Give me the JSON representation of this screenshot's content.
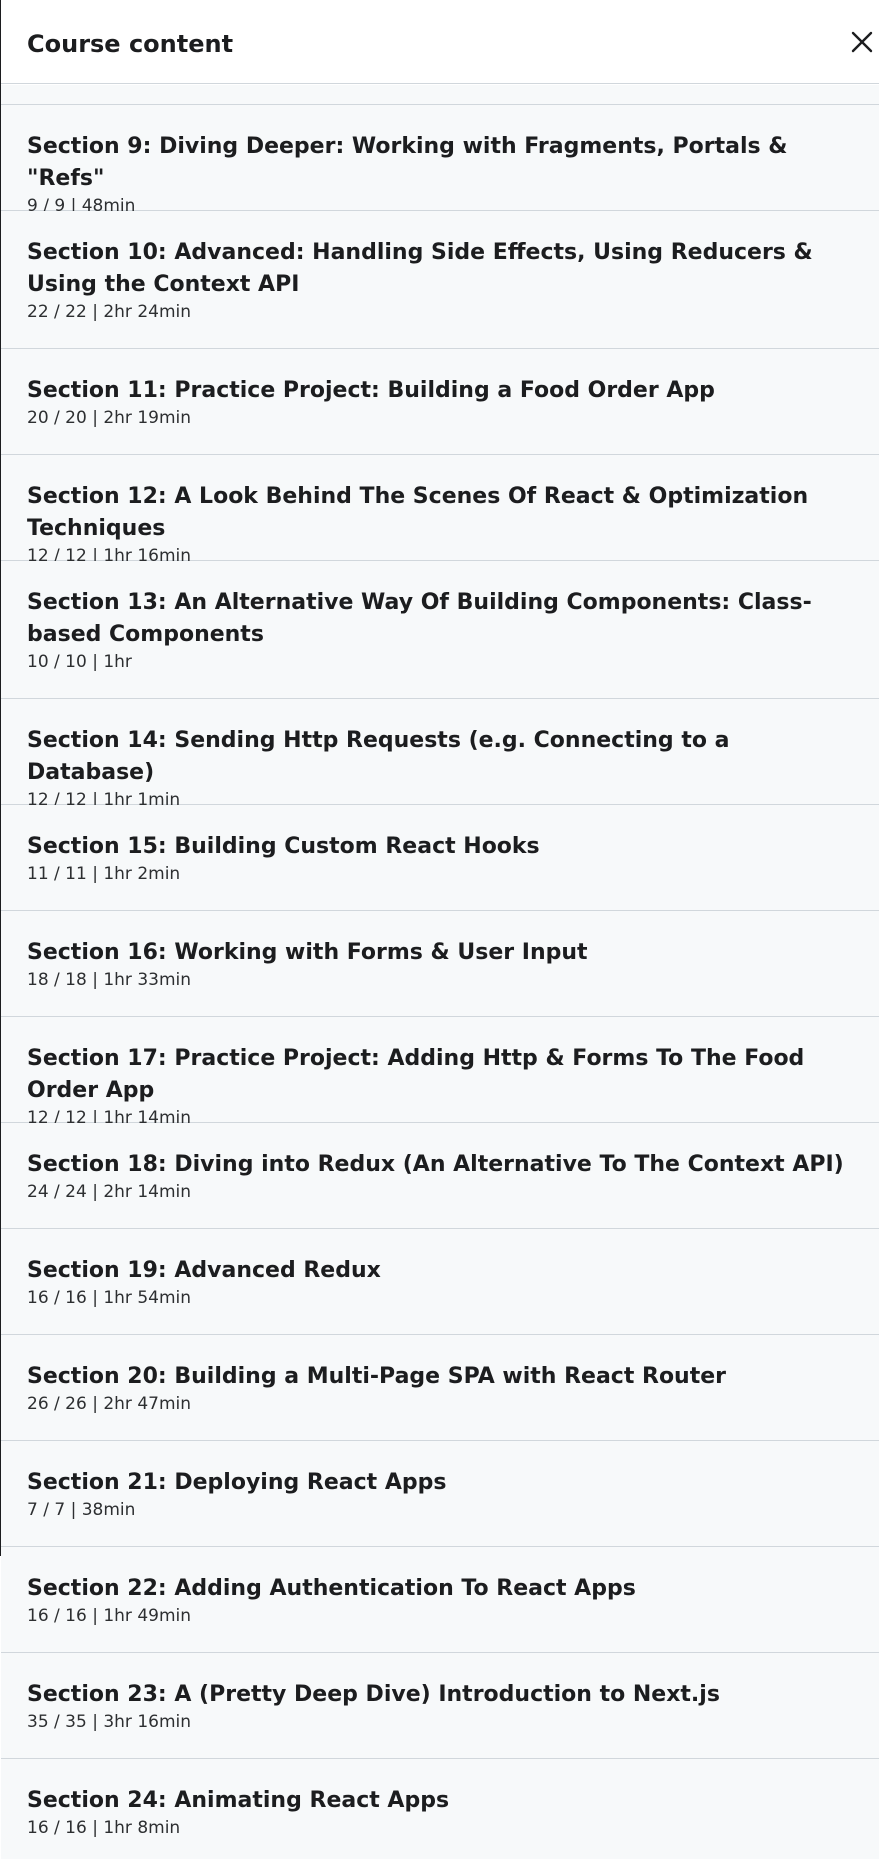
{
  "header": {
    "title": "Course content",
    "close_icon": "close-icon"
  },
  "sections": [
    {
      "title": "Section 9: Diving Deeper: Working with Fragments, Portals & \"Refs\"",
      "meta": "9 / 9 | 48min"
    },
    {
      "title": "Section 10: Advanced: Handling Side Effects, Using Reducers & Using the Context API",
      "meta": "22 / 22 | 2hr 24min"
    },
    {
      "title": "Section 11: Practice Project: Building a Food Order App",
      "meta": "20 / 20 | 2hr 19min"
    },
    {
      "title": "Section 12: A Look Behind The Scenes Of React & Optimization Techniques",
      "meta": "12 / 12 | 1hr 16min"
    },
    {
      "title": "Section 13: An Alternative Way Of Building Components: Class-based Components",
      "meta": "10 / 10 | 1hr"
    },
    {
      "title": "Section 14: Sending Http Requests (e.g. Connecting to a Database)",
      "meta": "12 / 12 | 1hr 1min"
    },
    {
      "title": "Section 15: Building Custom React Hooks",
      "meta": "11 / 11 | 1hr 2min"
    },
    {
      "title": "Section 16: Working with Forms & User Input",
      "meta": "18 / 18 | 1hr 33min"
    },
    {
      "title": "Section 17: Practice Project: Adding Http & Forms To The Food Order App",
      "meta": "12 / 12 | 1hr 14min"
    },
    {
      "title": "Section 18: Diving into Redux (An Alternative To The Context API)",
      "meta": "24 / 24 | 2hr 14min"
    },
    {
      "title": "Section 19: Advanced Redux",
      "meta": "16 / 16 | 1hr 54min"
    },
    {
      "title": "Section 20: Building a Multi-Page SPA with React Router",
      "meta": "26 / 26 | 2hr 47min"
    },
    {
      "title": "Section 21: Deploying React Apps",
      "meta": "7 / 7 | 38min"
    },
    {
      "title": "Section 22: Adding Authentication To React Apps",
      "meta": "16 / 16 | 1hr 49min"
    },
    {
      "title": "Section 23: A (Pretty Deep Dive) Introduction to Next.js",
      "meta": "35 / 35 | 3hr 16min"
    },
    {
      "title": "Section 24: Animating React Apps",
      "meta": "16 / 16 | 1hr 8min"
    }
  ]
}
